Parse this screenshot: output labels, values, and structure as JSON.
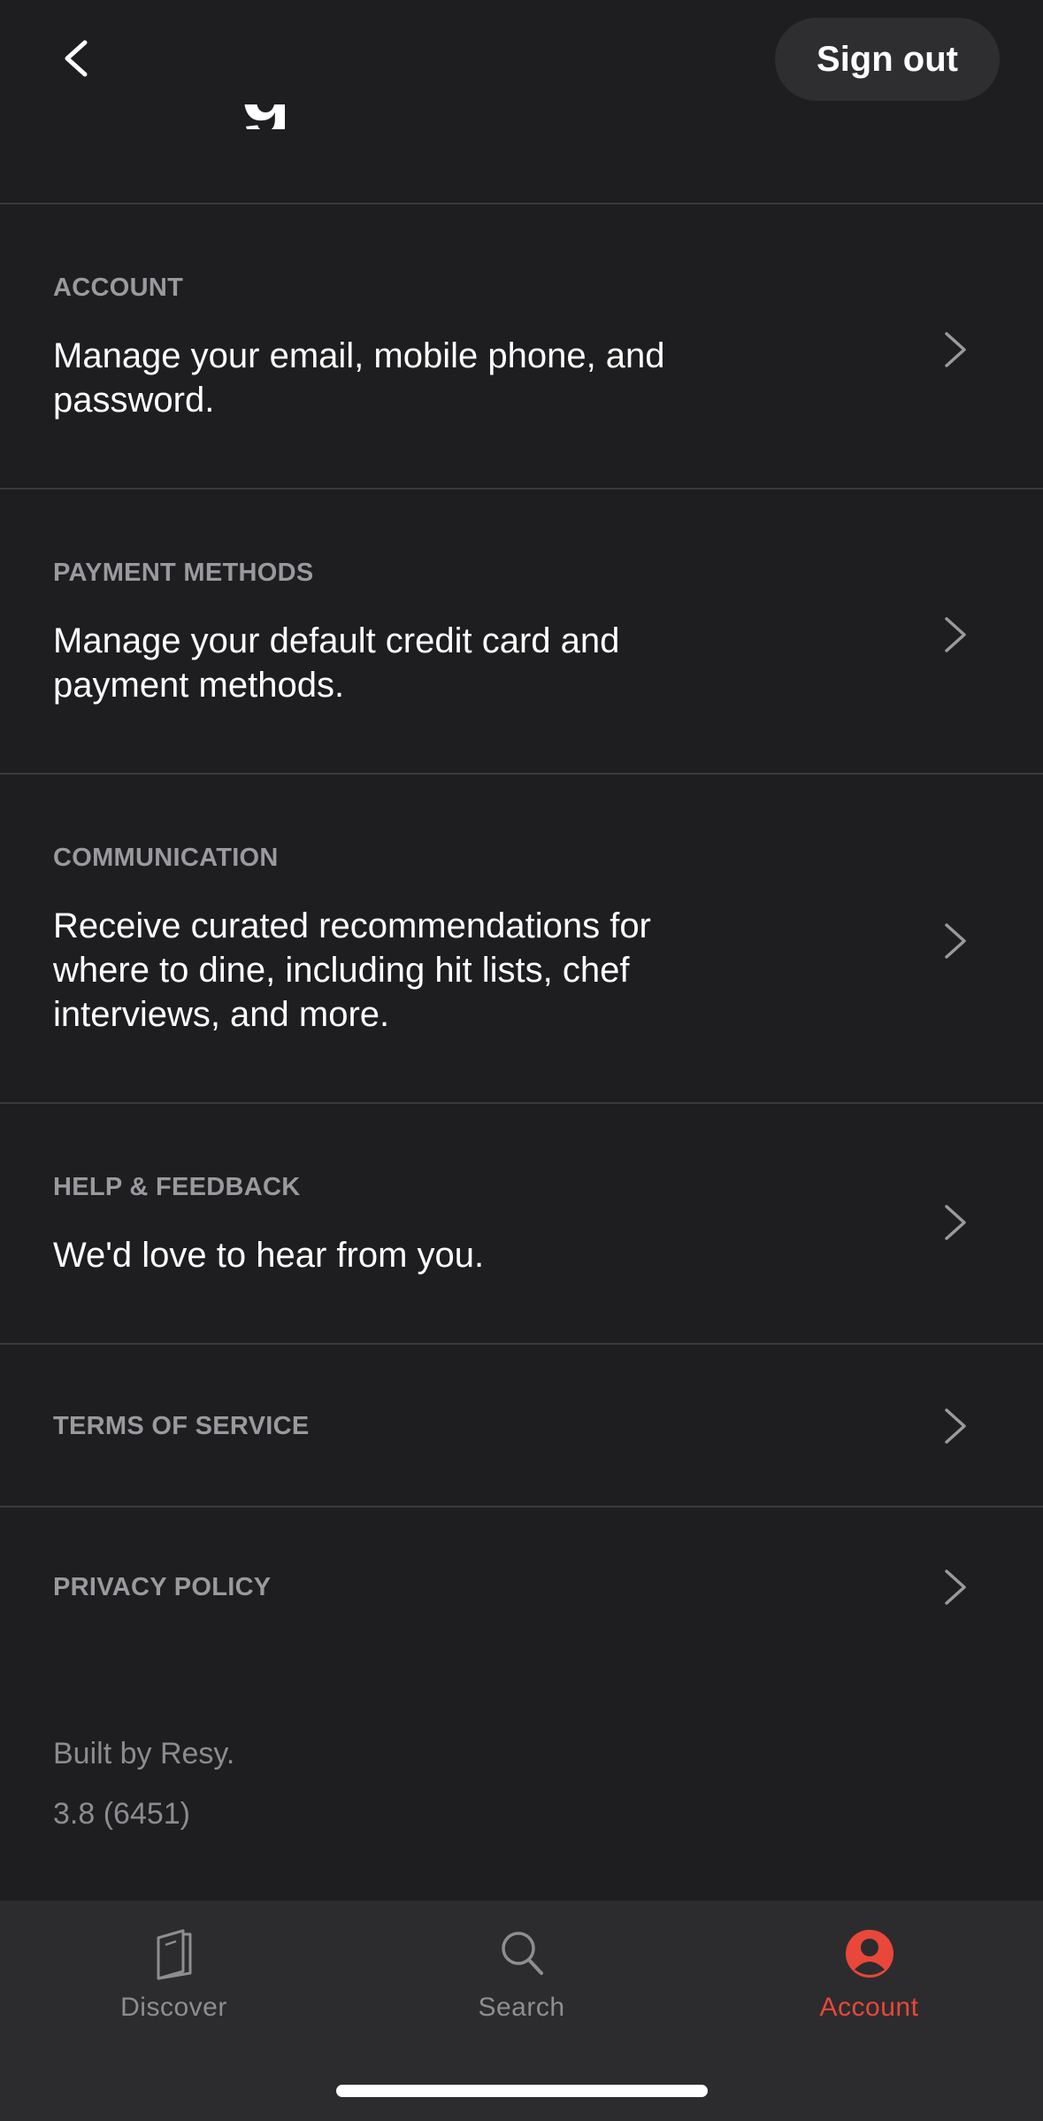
{
  "header": {
    "signout_label": "Sign out",
    "title_fragment": "g"
  },
  "rows": [
    {
      "label": "ACCOUNT",
      "desc": "Manage your email, mobile phone, and password."
    },
    {
      "label": "PAYMENT METHODS",
      "desc": "Manage your default credit card and payment methods."
    },
    {
      "label": "COMMUNICATION",
      "desc": "Receive curated recommendations for where to dine, including hit lists, chef interviews, and more."
    },
    {
      "label": "HELP & FEEDBACK",
      "desc": "We'd love to hear from you."
    },
    {
      "label": "TERMS OF SERVICE"
    },
    {
      "label": "PRIVACY POLICY"
    }
  ],
  "footer": {
    "built_by": "Built by Resy.",
    "version": "3.8 (6451)"
  },
  "tabbar": {
    "tabs": [
      {
        "label": "Discover",
        "icon": "book-icon",
        "active": false
      },
      {
        "label": "Search",
        "icon": "search-icon",
        "active": false
      },
      {
        "label": "Account",
        "icon": "user-icon",
        "active": true
      }
    ]
  },
  "colors": {
    "background": "#1e1e20",
    "accent": "#e8473a",
    "muted": "#9a9a9e"
  }
}
